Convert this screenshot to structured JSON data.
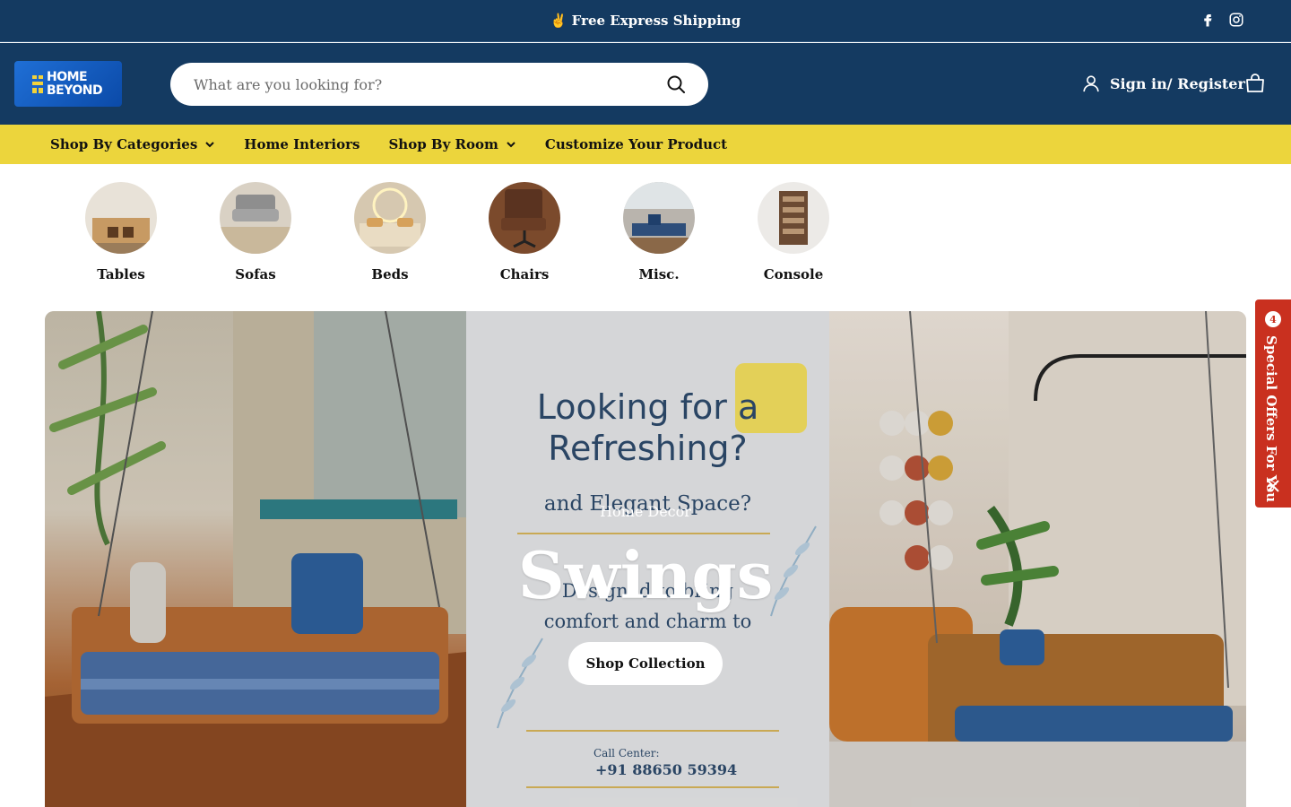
{
  "announcement": {
    "text": "✌️ Free Express Shipping"
  },
  "socials": [
    {
      "icon": "facebook-icon"
    },
    {
      "icon": "instagram-icon"
    }
  ],
  "header": {
    "logo_text_line1": "HOME",
    "logo_text_line2": "BEYOND",
    "search_placeholder": "What are you looking for?",
    "signin_label": "Sign in/ Register"
  },
  "nav": {
    "items": [
      {
        "label": "Shop By Categories",
        "dropdown": true
      },
      {
        "label": "Home Interiors",
        "dropdown": false
      },
      {
        "label": "Shop By Room",
        "dropdown": true
      },
      {
        "label": "Customize Your Product",
        "dropdown": false
      }
    ]
  },
  "categories": [
    {
      "label": "Tables"
    },
    {
      "label": "Sofas"
    },
    {
      "label": "Beds"
    },
    {
      "label": "Chairs"
    },
    {
      "label": "Misc."
    },
    {
      "label": "Console"
    }
  ],
  "hero": {
    "kicker": "Home Decor",
    "title": "Swings",
    "cta_label": "Shop Collection",
    "poster": {
      "line1": "Looking for a",
      "line2": "Refreshing?",
      "line3": "and Elegant Space?",
      "line4": "Designed to bring",
      "line5": "comfort and charm to",
      "call_label": "Call Center:",
      "phone": "+91 88650 59394"
    }
  },
  "offers_tab": {
    "badge_count": "4",
    "label": "Special Offers For You"
  },
  "colors": {
    "brand_navy": "#143a61",
    "nav_yellow": "#ecd53c",
    "offer_red": "#c9301f"
  }
}
